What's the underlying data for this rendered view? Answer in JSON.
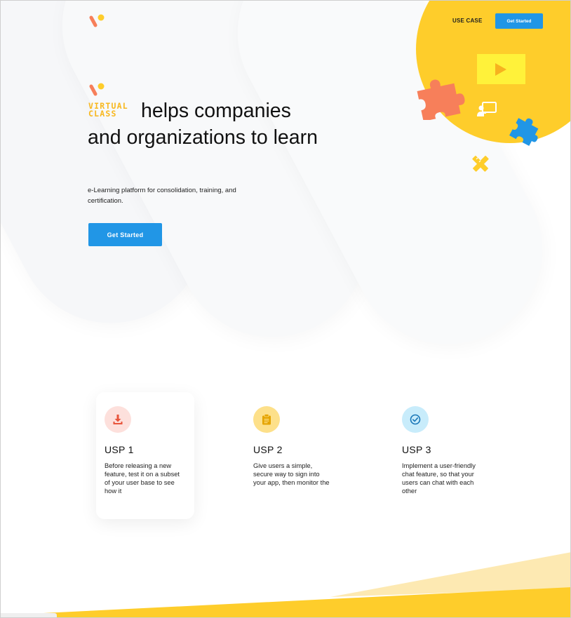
{
  "header": {
    "nav_link": "USE CASE",
    "cta_label": "Get Started"
  },
  "hero": {
    "brand_line1": "VIRTUAL",
    "brand_line2": "CLASS",
    "headline": "helps companies and organizations to learn",
    "subtext": "e-Learning platform for consolidation, training, and certification.",
    "cta_label": "Get Started"
  },
  "usps": [
    {
      "title": "USP 1",
      "text": "Before releasing a new feature, test it on a subset of your user base to see how it",
      "icon": "download-icon",
      "color": "#fde0dc",
      "icon_color": "#e8553c"
    },
    {
      "title": "USP 2",
      "text": "Give users a simple, secure way to sign into your app, then monitor the",
      "icon": "clipboard-icon",
      "color": "#fde08a",
      "icon_color": "#e5a400"
    },
    {
      "title": "USP 3",
      "text": "Implement a user-friendly chat feature, so that your users can chat with each other",
      "icon": "check-circle-icon",
      "color": "#c8ecfb",
      "icon_color": "#1a77b8"
    }
  ],
  "colors": {
    "accent_blue": "#2196e6",
    "accent_yellow": "#fecd2b",
    "accent_orange": "#f77f5a"
  }
}
